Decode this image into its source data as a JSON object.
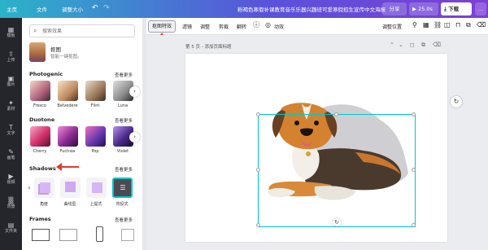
{
  "topbar": {
    "home": "主页",
    "file": "文件",
    "resize": "调整大小",
    "undo_icon": "undo-icon",
    "redo_icon": "redo-icon",
    "title": "粉褐色寒假补课教育音乐乐器兴趣班可爱寒假招生宣传中文海报",
    "share": "分享",
    "play": "25.0s",
    "download": "下载",
    "more": "…"
  },
  "rail": [
    {
      "icon": "▦",
      "label": "模板"
    },
    {
      "icon": "⇪",
      "label": "上传"
    },
    {
      "icon": "▣",
      "label": "图片"
    },
    {
      "icon": "✦",
      "label": "素材"
    },
    {
      "icon": "T",
      "label": "文字"
    },
    {
      "icon": "✎",
      "label": "画笔"
    },
    {
      "icon": "▶",
      "label": "视频"
    },
    {
      "icon": "▒",
      "label": "背景"
    },
    {
      "icon": "▤",
      "label": "文件夹"
    }
  ],
  "panel": {
    "search_placeholder": "搜索效果",
    "bg_remover": {
      "title": "抠图",
      "subtitle": "智能一键抠图。"
    },
    "photogenic": {
      "title": "Photogenic",
      "more": "查看更多",
      "items": [
        {
          "label": "Fresco",
          "color": "#b0607a"
        },
        {
          "label": "Belvedere",
          "color": "#c08a60"
        },
        {
          "label": "Flint",
          "color": "#9a7658"
        },
        {
          "label": "Luna",
          "color": "#8a8a8a"
        }
      ]
    },
    "duotone": {
      "title": "Duotone",
      "more": "查看更多",
      "items": [
        {
          "label": "Cherry",
          "color": "#d0306a"
        },
        {
          "label": "Fuchsia",
          "color": "#8a2a90"
        },
        {
          "label": "Pop",
          "color": "#6a3ab0"
        },
        {
          "label": "Violet",
          "color": "#4a2a8a"
        }
      ]
    },
    "shadows": {
      "title": "Shadows",
      "more": "查看更多",
      "items": [
        {
          "label": "角度"
        },
        {
          "label": "曲线型"
        },
        {
          "label": "上提式"
        },
        {
          "label": "背投式"
        }
      ]
    },
    "frames": {
      "title": "Frames",
      "more": "查看更多"
    }
  },
  "toolbar": {
    "items": [
      "抠图特效",
      "滤镜",
      "调整",
      "剪裁",
      "翻转"
    ],
    "info_icon": "info-icon",
    "animate": "动效",
    "position": "调整位置"
  },
  "canvas": {
    "page_label": "第 5 页 - 添加页面标题"
  },
  "colors": {
    "accent": "#00c4cc",
    "annotation_red": "#e8392f"
  }
}
